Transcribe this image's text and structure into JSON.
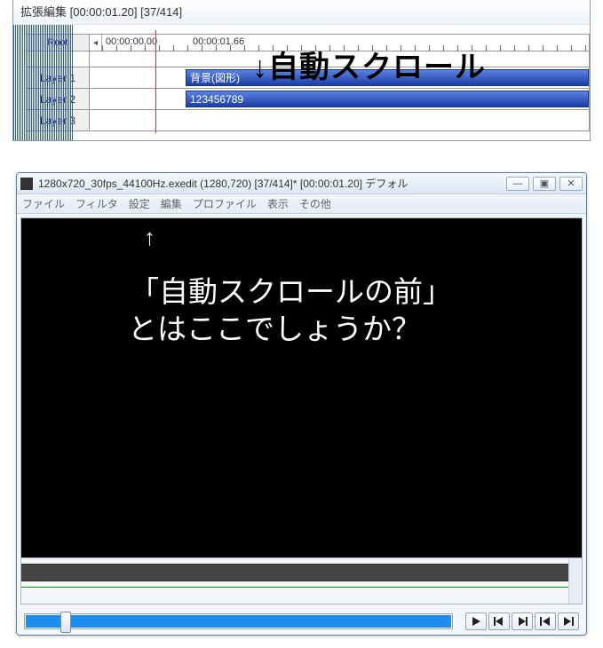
{
  "timeline": {
    "title": "拡張編集 [00:00:01.20] [37/414]",
    "root_label": "Root",
    "ruler_tc_1": "00:00:00.00",
    "ruler_tc_2": "00:00:01.66",
    "layers": [
      {
        "label": "Layer 1",
        "clip_label": "背景(図形)"
      },
      {
        "label": "Layer 2",
        "clip_label": "123456789"
      },
      {
        "label": "Layer 3",
        "clip_label": ""
      }
    ],
    "scroll_left_glyph": "◂"
  },
  "annotations": {
    "top": "↓自動スクロール",
    "arrow_up": "↑",
    "line1": "「自動スクロールの前」",
    "line2": "とはここでしょうか？"
  },
  "preview": {
    "title": "1280x720_30fps_44100Hz.exedit (1280,720)  [37/414]* [00:00:01.20]  デフォル",
    "win_min": "—",
    "win_max": "▣",
    "win_close": "✕",
    "menu": {
      "file": "ファイル",
      "filter": "フィルタ",
      "settings": "設定",
      "edit": "編集",
      "profile": "プロファイル",
      "display": "表示",
      "other": "その他"
    }
  }
}
